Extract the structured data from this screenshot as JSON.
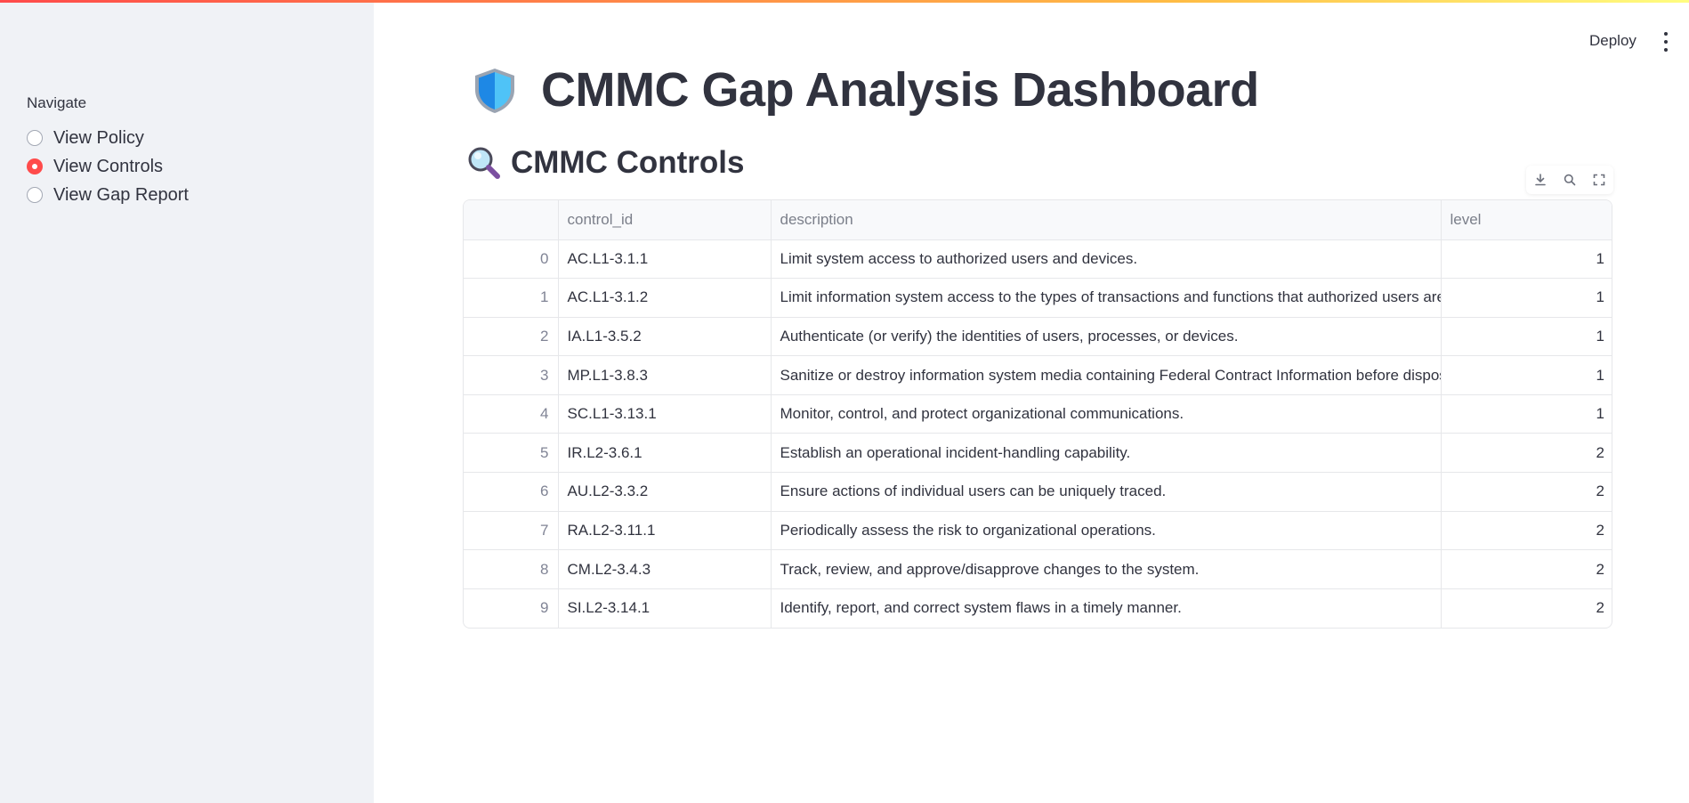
{
  "app": {
    "deploy_label": "Deploy"
  },
  "sidebar": {
    "nav_label": "Navigate",
    "options": [
      {
        "label": "View Policy",
        "selected": false
      },
      {
        "label": "View Controls",
        "selected": true
      },
      {
        "label": "View Gap Report",
        "selected": false
      }
    ]
  },
  "main": {
    "title": "CMMC Gap Analysis Dashboard",
    "subtitle": "CMMC Controls",
    "title_icon": "shield-icon",
    "subtitle_icon": "magnifying-glass-icon"
  },
  "toolbar": {
    "icons": [
      "download-icon",
      "search-icon",
      "fullscreen-icon"
    ]
  },
  "table": {
    "columns": [
      "",
      "control_id",
      "description",
      "level"
    ],
    "rows": [
      {
        "index": "0",
        "control_id": "AC.L1-3.1.1",
        "description": "Limit system access to authorized users and devices.",
        "level": "1"
      },
      {
        "index": "1",
        "control_id": "AC.L1-3.1.2",
        "description": "Limit information system access to the types of transactions and functions that authorized users are pe",
        "level": "1"
      },
      {
        "index": "2",
        "control_id": "IA.L1-3.5.2",
        "description": "Authenticate (or verify) the identities of users, processes, or devices.",
        "level": "1"
      },
      {
        "index": "3",
        "control_id": "MP.L1-3.8.3",
        "description": "Sanitize or destroy information system media containing Federal Contract Information before disposal",
        "level": "1"
      },
      {
        "index": "4",
        "control_id": "SC.L1-3.13.1",
        "description": "Monitor, control, and protect organizational communications.",
        "level": "1"
      },
      {
        "index": "5",
        "control_id": "IR.L2-3.6.1",
        "description": "Establish an operational incident-handling capability.",
        "level": "2"
      },
      {
        "index": "6",
        "control_id": "AU.L2-3.3.2",
        "description": "Ensure actions of individual users can be uniquely traced.",
        "level": "2"
      },
      {
        "index": "7",
        "control_id": "RA.L2-3.11.1",
        "description": "Periodically assess the risk to organizational operations.",
        "level": "2"
      },
      {
        "index": "8",
        "control_id": "CM.L2-3.4.3",
        "description": "Track, review, and approve/disapprove changes to the system.",
        "level": "2"
      },
      {
        "index": "9",
        "control_id": "SI.L2-3.14.1",
        "description": "Identify, report, and correct system flaws in a timely manner.",
        "level": "2"
      }
    ]
  },
  "colors": {
    "accent": "#ff4b4b",
    "sidebar_bg": "#f0f2f6",
    "text": "#31333f"
  }
}
